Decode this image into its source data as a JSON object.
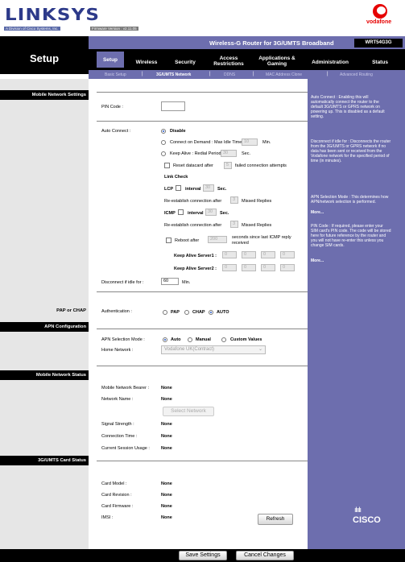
{
  "brand": {
    "logo": "LINKSYS",
    "logo_sub": "A Division of Cisco Systems, Inc.",
    "firmware": "Firmware Version : v2.11.05",
    "vodafone": "vodafone",
    "cisco": "CISCO"
  },
  "header": {
    "product": "Wireless-G Router for 3G/UMTS Broadband",
    "model": "WRT54G3G",
    "section": "Setup"
  },
  "tabs": [
    {
      "label": "Setup"
    },
    {
      "label": "Wireless"
    },
    {
      "label": "Security"
    },
    {
      "label": "Access Restrictions"
    },
    {
      "label": "Applications & Gaming"
    },
    {
      "label": "Administration"
    },
    {
      "label": "Status"
    }
  ],
  "subtabs": [
    {
      "label": "Basic Setup"
    },
    {
      "label": "3G/UMTS Network"
    },
    {
      "label": "DDNS"
    },
    {
      "label": "MAC Address Clone"
    },
    {
      "label": "Advanced Routing"
    }
  ],
  "sidebar": {
    "mobile_network_settings": "Mobile Network Settings",
    "pap_or_chap": "PAP or CHAP",
    "apn_configuration": "APN Configuration",
    "mobile_network_status": "Mobile Network Status",
    "card_status": "3G/UMTS Card Status"
  },
  "form": {
    "pin_code": "PIN Code :",
    "auto_connect": "Auto Connect :",
    "disable": "Disable",
    "connect_on_demand": "Connect on Demand : Max Idle Time",
    "idle_time": "10",
    "min": "Min.",
    "keep_alive": "Keep Alive : Redial Period",
    "redial": "30",
    "sec": "Sec.",
    "reset_datacard": "Reset datacard after",
    "reset_value": "5",
    "failed_attempts": "failed connection attempts",
    "link_check": "Link Check",
    "lcp": "LCP",
    "interval": "interval",
    "lcp_interval": "30",
    "reestablish1": "Re-establish connection after",
    "lcp_missed": "3",
    "missed_replies": "Missed Replies",
    "icmp": "ICMP",
    "icmp_interval": "30",
    "reestablish2": "Re-establish connection after",
    "icmp_missed": "3",
    "reboot_after": "Reboot after",
    "reboot_value": "200",
    "seconds_since": "seconds since last ICMP reply",
    "received": "received",
    "keep_alive_server1": "Keep Alive Server1 :",
    "server1": [
      "0",
      "0",
      "0",
      "0"
    ],
    "keep_alive_server2": "Keep Alive Server2 :",
    "server2": [
      "0",
      "0",
      "0",
      "0"
    ],
    "disconnect_idle": "Disconnect if idle for :",
    "disconnect_value": "60",
    "authentication": "Authentication :",
    "pap": "PAP",
    "chap": "CHAP",
    "auto": "AUTO",
    "apn_selection_mode": "APN Selection Mode :",
    "mode_auto": "Auto",
    "mode_manual": "Manual",
    "mode_custom": "Custom Values",
    "home_network": "Home Network :",
    "home_network_value": "Vodafone UK(Contract)"
  },
  "status": {
    "bearer": "Mobile Network  Bearer :",
    "bearer_value": "None",
    "network_name": "Network Name :",
    "network_name_value": "None",
    "select_network": "Select Network",
    "signal_strength": "Signal Strength :",
    "signal_value": "None",
    "connection_time": "Connection Time :",
    "connection_value": "None",
    "current_session": "Current Session Usage :",
    "session_value": "None",
    "card_model": "Card Model :",
    "card_model_value": "None",
    "card_revision": "Card Revision :",
    "card_revision_value": "None",
    "card_firmware": "Card Firmware :",
    "card_firmware_value": "None",
    "imsi": "IMSI :",
    "imsi_value": "None",
    "refresh": "Refresh"
  },
  "help": {
    "auto_connect": "Auto Connect : Enabling this will automatically connect the router to the default 3G/UMTS or GPRS network on powering up. This is disabled as a default setting.",
    "disconnect": "Disconnect if idle for : Disconnects the router from the 3G/UMTS or GPRS network if no data has been sent or received from the Vodafone network for the specified period of time (in minutes).",
    "apn": "APN Selection Mode : This determines how APN/network selection is performed.",
    "more1": "More...",
    "pin": "PIN Code : If required, please enter your SIM card's PIN code. The code will be stored here for future reference by the router and you will not have re-enter this unless you change SIM cards.",
    "more2": "More..."
  },
  "footer": {
    "save": "Save Settings",
    "cancel": "Cancel Changes"
  }
}
